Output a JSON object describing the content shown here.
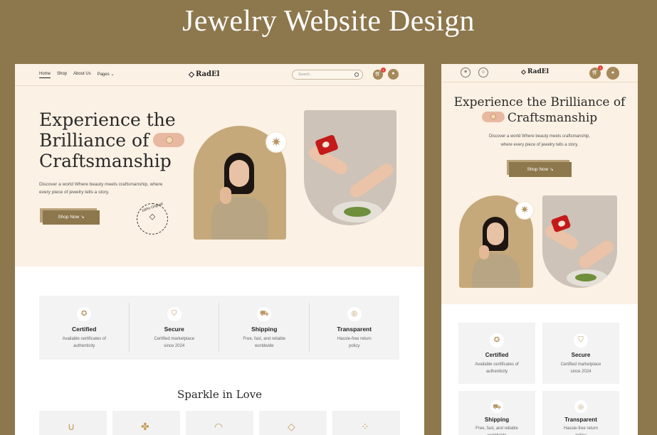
{
  "banner": {
    "title": "Jewelry Website Design"
  },
  "brand": {
    "name": "RadEl",
    "accent": "#8d774c"
  },
  "nav": {
    "links": [
      "Home",
      "Shop",
      "About Us",
      "Pages"
    ],
    "search_placeholder": "Search...",
    "cart_count": "1"
  },
  "hero": {
    "title_line1": "Experience the",
    "title_line2": "Brilliance of",
    "title_line3": "Craftsmanship",
    "subtitle_line1": "Discover a world Where beauty meets craftsmanship, where",
    "subtitle_line2": "every piece of jewelry tells a story.",
    "cta": "Shop Now",
    "seal_text": "100% Original"
  },
  "mobile_hero": {
    "title_line1": "Experience the Brilliance of",
    "title_line2": "Craftsmanship",
    "subtitle_line1": "Discover a world Where beauty meets craftsmanship,",
    "subtitle_line2": "where every piece of jewelry tells a story.",
    "cta": "Shop Now"
  },
  "features": [
    {
      "title": "Certified",
      "desc1": "Available certificates of",
      "desc2": "authenticity",
      "icon": "medal-icon"
    },
    {
      "title": "Secure",
      "desc1": "Certified marketplace",
      "desc2": "since 2024",
      "icon": "shield-icon"
    },
    {
      "title": "Shipping",
      "desc1": "Free, fast, and reliable",
      "desc2": "worldwide",
      "icon": "truck-icon"
    },
    {
      "title": "Transparent",
      "desc1": "Hassle-free return",
      "desc2": "policy",
      "icon": "coins-icon"
    }
  ],
  "section": {
    "title": "Sparkle in Love"
  }
}
